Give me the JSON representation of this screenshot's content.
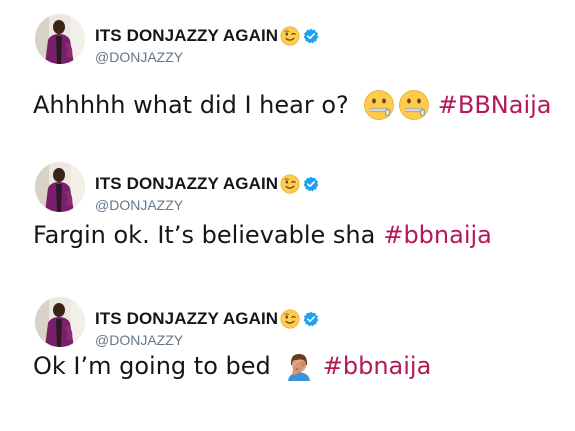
{
  "tweets": [
    {
      "display_name": "ITS DONJAZZY AGAIN",
      "handle": "@DONJAZZY",
      "name_emoji": "winking-face-icon",
      "verified": true,
      "text": "Ahhhhh what did I hear o?",
      "emojis": [
        "zipper-mouth-face-icon",
        "zipper-mouth-face-icon"
      ],
      "hashtag": "#BBNaija"
    },
    {
      "display_name": "ITS DONJAZZY AGAIN",
      "handle": "@DONJAZZY",
      "name_emoji": "winking-face-icon",
      "verified": true,
      "text": "Fargin ok. It’s believable sha",
      "emojis": [],
      "hashtag": "#bbnaija"
    },
    {
      "display_name": "ITS DONJAZZY AGAIN",
      "handle": "@DONJAZZY",
      "name_emoji": "winking-face-icon",
      "verified": true,
      "text": "Ok I’m going to bed",
      "emojis": [
        "man-facepalming-icon"
      ],
      "hashtag": "#bbnaija"
    }
  ],
  "colors": {
    "name": "#14171a",
    "handle": "#657786",
    "text": "#14171a",
    "hashtag": "#b3185a",
    "verified": "#1da1f2"
  }
}
